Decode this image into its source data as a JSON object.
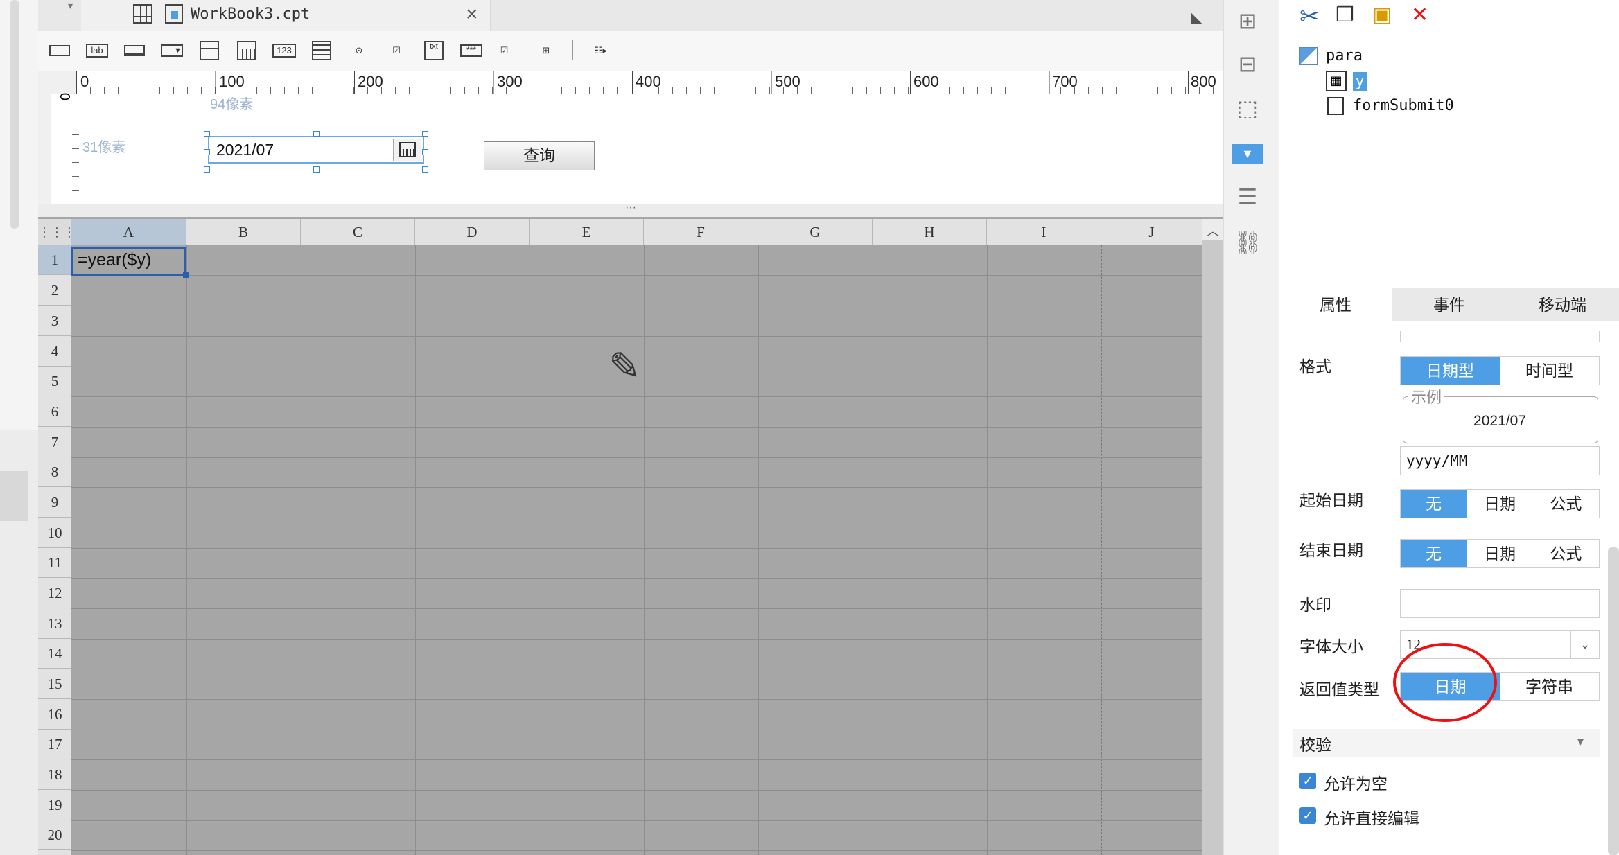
{
  "tab": {
    "title": "WorkBook3.cpt",
    "close": "×"
  },
  "ruler": {
    "ticks": [
      "0",
      "100",
      "200",
      "300",
      "400",
      "500",
      "600",
      "700",
      "800"
    ],
    "vertical_zero": "0"
  },
  "param_pane": {
    "label_94": "94像素",
    "label_31": "31像素",
    "date_value": "2021/07",
    "query_button": "查询"
  },
  "grid": {
    "columns": [
      "A",
      "B",
      "C",
      "D",
      "E",
      "F",
      "G",
      "H",
      "I",
      "J"
    ],
    "rows": [
      "1",
      "2",
      "3",
      "4",
      "5",
      "6",
      "7",
      "8",
      "9",
      "10",
      "11",
      "12",
      "13",
      "14",
      "15",
      "16",
      "17",
      "18",
      "19",
      "20"
    ],
    "a1_formula": "=year($y)"
  },
  "tree": {
    "root": "para",
    "child_selected": "y",
    "child2": "formSubmit0"
  },
  "panel_tabs": [
    "属性",
    "事件",
    "移动端"
  ],
  "properties": {
    "format_label": "格式",
    "format_options": [
      "日期型",
      "时间型"
    ],
    "example_legend": "示例",
    "example_value": "2021/07",
    "format_pattern": "yyyy/MM",
    "start_label": "起始日期",
    "end_label": "结束日期",
    "range_options": [
      "无",
      "日期",
      "公式"
    ],
    "watermark_label": "水印",
    "watermark_value": "",
    "font_size_label": "字体大小",
    "font_size_value": "12",
    "return_label": "返回值类型",
    "return_options": [
      "日期",
      "字符串"
    ],
    "validation_title": "校验",
    "allow_empty": "允许为空",
    "allow_direct_edit": "允许直接编辑"
  },
  "colors": {
    "accent": "#4e9ee5",
    "highlight": "#e11111",
    "grid_bg": "#a6a6a6"
  }
}
